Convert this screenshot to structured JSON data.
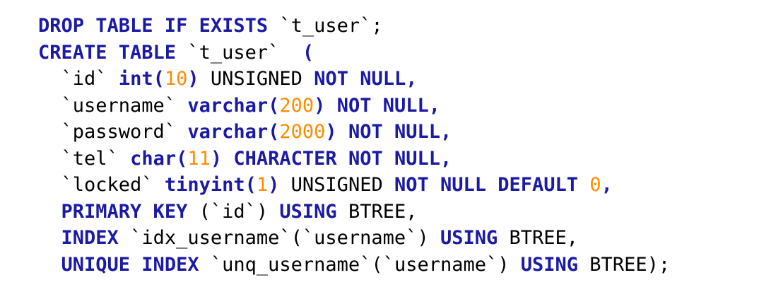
{
  "colors": {
    "keyword": "#1a1aa6",
    "number": "#ff8c00",
    "identifier": "#000000",
    "background": "#ffffff"
  },
  "code_lines": [
    {
      "indent": "",
      "tokens": [
        {
          "type": "kw",
          "text": "DROP TABLE IF EXISTS"
        },
        {
          "type": "plain",
          "text": " "
        },
        {
          "type": "ident",
          "text": "`t_user`"
        },
        {
          "type": "plain",
          "text": ";"
        }
      ]
    },
    {
      "indent": "",
      "tokens": [
        {
          "type": "kw",
          "text": "CREATE TABLE"
        },
        {
          "type": "plain",
          "text": " "
        },
        {
          "type": "ident",
          "text": "`t_user`"
        },
        {
          "type": "plain",
          "text": "  "
        },
        {
          "type": "kw",
          "text": "("
        }
      ]
    },
    {
      "indent": "  ",
      "tokens": [
        {
          "type": "ident",
          "text": "`id`"
        },
        {
          "type": "plain",
          "text": " "
        },
        {
          "type": "kw",
          "text": "int("
        },
        {
          "type": "num",
          "text": "10"
        },
        {
          "type": "kw",
          "text": ")"
        },
        {
          "type": "plain",
          "text": " UNSIGNED "
        },
        {
          "type": "kw",
          "text": "NOT NULL,"
        }
      ]
    },
    {
      "indent": "  ",
      "tokens": [
        {
          "type": "ident",
          "text": "`username`"
        },
        {
          "type": "plain",
          "text": " "
        },
        {
          "type": "kw",
          "text": "varchar("
        },
        {
          "type": "num",
          "text": "200"
        },
        {
          "type": "kw",
          "text": ")"
        },
        {
          "type": "plain",
          "text": " "
        },
        {
          "type": "kw",
          "text": "NOT NULL,"
        }
      ]
    },
    {
      "indent": "  ",
      "tokens": [
        {
          "type": "ident",
          "text": "`password`"
        },
        {
          "type": "plain",
          "text": " "
        },
        {
          "type": "kw",
          "text": "varchar("
        },
        {
          "type": "num",
          "text": "2000"
        },
        {
          "type": "kw",
          "text": ")"
        },
        {
          "type": "plain",
          "text": " "
        },
        {
          "type": "kw",
          "text": "NOT NULL,"
        }
      ]
    },
    {
      "indent": "  ",
      "tokens": [
        {
          "type": "ident",
          "text": "`tel`"
        },
        {
          "type": "plain",
          "text": " "
        },
        {
          "type": "kw",
          "text": "char("
        },
        {
          "type": "num",
          "text": "11"
        },
        {
          "type": "kw",
          "text": ")"
        },
        {
          "type": "plain",
          "text": " "
        },
        {
          "type": "kw",
          "text": "CHARACTER NOT NULL,"
        }
      ]
    },
    {
      "indent": "  ",
      "tokens": [
        {
          "type": "ident",
          "text": "`locked`"
        },
        {
          "type": "plain",
          "text": " "
        },
        {
          "type": "kw",
          "text": "tinyint("
        },
        {
          "type": "num",
          "text": "1"
        },
        {
          "type": "kw",
          "text": ")"
        },
        {
          "type": "plain",
          "text": " UNSIGNED "
        },
        {
          "type": "kw",
          "text": "NOT NULL DEFAULT"
        },
        {
          "type": "plain",
          "text": " "
        },
        {
          "type": "num",
          "text": "0"
        },
        {
          "type": "kw",
          "text": ","
        }
      ]
    },
    {
      "indent": "  ",
      "tokens": [
        {
          "type": "kw",
          "text": "PRIMARY KEY"
        },
        {
          "type": "plain",
          "text": " "
        },
        {
          "type": "ident",
          "text": "(`id`)"
        },
        {
          "type": "plain",
          "text": " "
        },
        {
          "type": "kw",
          "text": "USING"
        },
        {
          "type": "plain",
          "text": " BTREE,"
        }
      ]
    },
    {
      "indent": "  ",
      "tokens": [
        {
          "type": "kw",
          "text": "INDEX"
        },
        {
          "type": "plain",
          "text": " "
        },
        {
          "type": "ident",
          "text": "`idx_username`(`username`)"
        },
        {
          "type": "plain",
          "text": " "
        },
        {
          "type": "kw",
          "text": "USING"
        },
        {
          "type": "plain",
          "text": " BTREE,"
        }
      ]
    },
    {
      "indent": "  ",
      "tokens": [
        {
          "type": "kw",
          "text": "UNIQUE INDEX"
        },
        {
          "type": "plain",
          "text": " "
        },
        {
          "type": "ident",
          "text": "`unq_username`(`username`)"
        },
        {
          "type": "plain",
          "text": " "
        },
        {
          "type": "kw",
          "text": "USING"
        },
        {
          "type": "plain",
          "text": " BTREE);"
        }
      ]
    }
  ]
}
